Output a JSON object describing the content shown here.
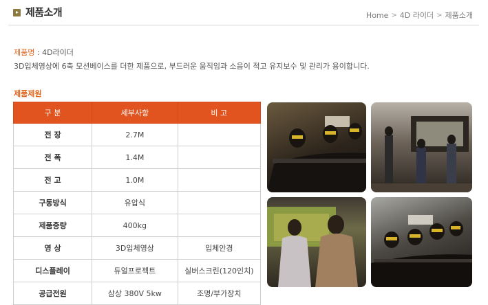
{
  "header": {
    "title": "제품소개",
    "breadcrumb": [
      "Home",
      "4D 라이더",
      "제품소개"
    ]
  },
  "intro": {
    "name_label": "제품명",
    "name_value": " : 4D라이더",
    "description": "3D입체영상에 6축 모션베이스를 더한 제품으로, 부드러운 움직임과 소음이 적고 유지보수 및 관리가 용이합니다."
  },
  "spec": {
    "section_title": "제품제원",
    "headers": [
      "구 분",
      "세부사항",
      "비 고"
    ],
    "rows": [
      [
        "전 장",
        "2.7M",
        ""
      ],
      [
        "전 폭",
        "1.4M",
        ""
      ],
      [
        "전 고",
        "1.0M",
        ""
      ],
      [
        "구동방식",
        "유압식",
        ""
      ],
      [
        "제품중량",
        "400kg",
        ""
      ],
      [
        "영 상",
        "3D입체영상",
        "입체안경"
      ],
      [
        "디스플레이",
        "듀얼프로젝트",
        "실버스크린(120인치)"
      ],
      [
        "공급전원",
        "삼상 380V 5kw",
        "조명/부가장치"
      ]
    ]
  },
  "colors": {
    "accent": "#e0641a",
    "table_header": "#e1531f"
  }
}
